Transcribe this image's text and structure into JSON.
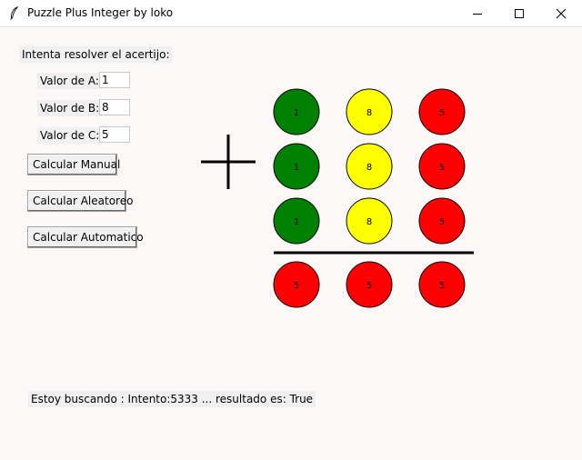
{
  "window": {
    "title": "Puzzle Plus Integer by loko",
    "icon": "feather-icon",
    "controls": [
      "minimize-icon",
      "maximize-icon",
      "close-icon"
    ]
  },
  "form": {
    "heading": "Intenta resolver el acertijo:",
    "field_a": {
      "label": "Valor de A:",
      "value": "1"
    },
    "field_b": {
      "label": "Valor de B:",
      "value": "8"
    },
    "field_c": {
      "label": "Valor de C:",
      "value": "5"
    },
    "buttons": {
      "manual": "Calcular Manual",
      "random": "Calcular Aleatoreo",
      "auto": "Calcular Automatico"
    }
  },
  "puzzle": {
    "operator": "plus",
    "rows": [
      [
        {
          "value": "1",
          "color": "#008000"
        },
        {
          "value": "8",
          "color": "#ffff00"
        },
        {
          "value": "5",
          "color": "#ff0000"
        }
      ],
      [
        {
          "value": "1",
          "color": "#008000"
        },
        {
          "value": "8",
          "color": "#ffff00"
        },
        {
          "value": "5",
          "color": "#ff0000"
        }
      ],
      [
        {
          "value": "1",
          "color": "#008000"
        },
        {
          "value": "8",
          "color": "#ffff00"
        },
        {
          "value": "5",
          "color": "#ff0000"
        }
      ]
    ],
    "result": [
      {
        "value": "5",
        "color": "#ff0000"
      },
      {
        "value": "5",
        "color": "#ff0000"
      },
      {
        "value": "5",
        "color": "#ff0000"
      }
    ]
  },
  "status": "Estoy buscando : Intento:5333 ... resultado es: True"
}
